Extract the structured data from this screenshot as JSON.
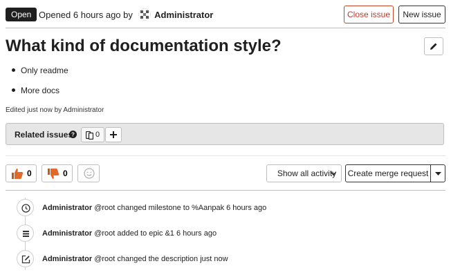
{
  "header": {
    "status": "Open",
    "opened_text": "Opened 6 hours ago by",
    "author": "Administrator",
    "close_label": "Close issue",
    "new_label": "New issue"
  },
  "issue": {
    "title": "What kind of documentation style?",
    "description_items": [
      "Only readme",
      "More docs"
    ],
    "edited_text": "Edited just now by Administrator"
  },
  "related": {
    "title": "Related issues",
    "count": "0"
  },
  "awards": {
    "thumbs_up": "0",
    "thumbs_down": "0"
  },
  "actions": {
    "activity_label": "Show all activity",
    "merge_request_label": "Create merge request"
  },
  "timeline": [
    {
      "author": "Administrator",
      "rest": "@root changed milestone to %Aanpak 6 hours ago",
      "icon": "clock-icon"
    },
    {
      "author": "Administrator",
      "rest": "@root added to epic &1 6 hours ago",
      "icon": "epic-icon"
    },
    {
      "author": "Administrator",
      "rest": "@root changed the description just now",
      "icon": "pencil-square-icon"
    }
  ],
  "colors": {
    "close_border": "#c74725",
    "status_bg": "#1f1f1f",
    "award_orange": "#e06a2b"
  }
}
